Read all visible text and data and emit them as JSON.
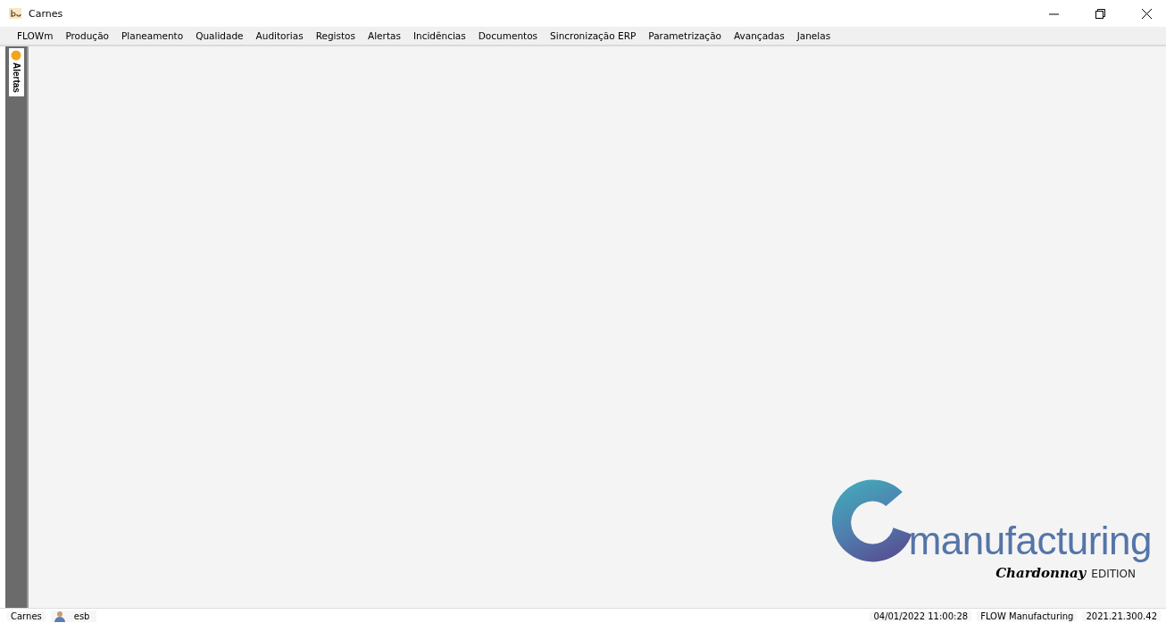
{
  "window": {
    "title": "Carnes"
  },
  "menu": [
    "FLOWm",
    "Produção",
    "Planeamento",
    "Qualidade",
    "Auditorias",
    "Registos",
    "Alertas",
    "Incidências",
    "Documentos",
    "Sincronização ERP",
    "Parametrização",
    "Avançadas",
    "Janelas"
  ],
  "side_tab": {
    "label": "Alertas"
  },
  "logo": {
    "word": "manufacturing",
    "script": "Chardonnay",
    "edition": "EDITION"
  },
  "status_bar": {
    "company": "Carnes",
    "user": "esb",
    "datetime": "04/01/2022 11:00:28",
    "product": "FLOW Manufacturing",
    "version": "2021.21.300.42"
  }
}
